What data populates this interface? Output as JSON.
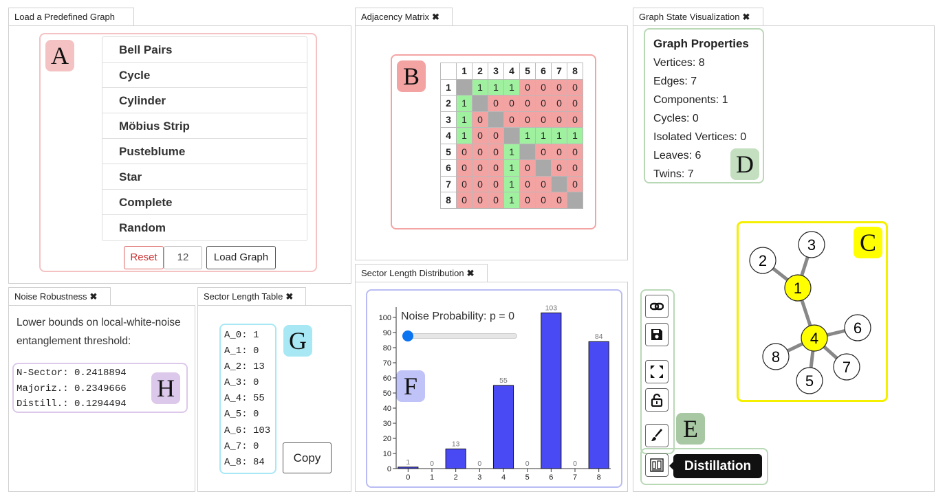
{
  "load_panel": {
    "tab_label": "Load a Predefined Graph",
    "annotation": "A",
    "graphs": [
      "Bell Pairs",
      "Cycle",
      "Cylinder",
      "Möbius Strip",
      "Pusteblume",
      "Star",
      "Complete",
      "Random"
    ],
    "reset_label": "Reset",
    "size_value": "12",
    "load_label": "Load Graph"
  },
  "adjacency_panel": {
    "tab_label": "Adjacency Matrix",
    "annotation": "B",
    "headers": [
      "1",
      "2",
      "3",
      "4",
      "5",
      "6",
      "7",
      "8"
    ],
    "rows": [
      [
        "",
        "1",
        "1",
        "1",
        "0",
        "0",
        "0",
        "0"
      ],
      [
        "1",
        "",
        "0",
        "0",
        "0",
        "0",
        "0",
        "0"
      ],
      [
        "1",
        "0",
        "",
        "0",
        "0",
        "0",
        "0",
        "0"
      ],
      [
        "1",
        "0",
        "0",
        "",
        "1",
        "1",
        "1",
        "1"
      ],
      [
        "0",
        "0",
        "0",
        "1",
        "",
        "0",
        "0",
        "0"
      ],
      [
        "0",
        "0",
        "0",
        "1",
        "0",
        "",
        "0",
        "0"
      ],
      [
        "0",
        "0",
        "0",
        "1",
        "0",
        "0",
        "",
        "0"
      ],
      [
        "0",
        "0",
        "0",
        "1",
        "0",
        "0",
        "0",
        ""
      ]
    ]
  },
  "graph_panel": {
    "tab_label": "Graph State Visualization",
    "properties_title": "Graph Properties",
    "properties": [
      "Vertices: 8",
      "Edges: 7",
      "Components: 1",
      "Cycles: 0",
      "Isolated Vertices: 0",
      "Leaves: 6",
      "Twins: 7"
    ],
    "annotation_props": "D",
    "annotation_graph": "C",
    "annotation_tools": "E",
    "nodes": [
      "1",
      "2",
      "3",
      "4",
      "5",
      "6",
      "7",
      "8"
    ],
    "highlight_color": "#ffff00",
    "tools": [
      "link-icon",
      "save-icon",
      "fit-view-icon",
      "unlock-icon",
      "brush-icon",
      "distillation-icon"
    ],
    "tooltip": "Distillation"
  },
  "noise_panel": {
    "tab_label": "Noise Robustness",
    "description": "Lower bounds on local-white-noise entanglement threshold:",
    "annotation": "H",
    "lines": [
      "N-Sector: 0.2418894",
      "Majoriz.: 0.2349666",
      "Distill.: 0.1294494"
    ]
  },
  "sector_table_panel": {
    "tab_label": "Sector Length Table",
    "annotation": "G",
    "lines": [
      "A_0: 1",
      "A_1: 0",
      "A_2: 13",
      "A_3: 0",
      "A_4: 55",
      "A_5: 0",
      "A_6: 103",
      "A_7: 0",
      "A_8: 84"
    ],
    "copy_label": "Copy"
  },
  "sector_dist_panel": {
    "tab_label": "Sector Length Distribution",
    "annotation": "F",
    "slider_label": "Noise Probability: p = 0",
    "slider_value": 0
  },
  "chart_data": {
    "type": "bar",
    "categories": [
      "0",
      "1",
      "2",
      "3",
      "4",
      "5",
      "6",
      "7",
      "8"
    ],
    "values": [
      1,
      0,
      13,
      0,
      55,
      0,
      103,
      0,
      84
    ],
    "ylim": [
      0,
      105
    ],
    "yticks": [
      "0",
      "10",
      "20",
      "30",
      "40",
      "50",
      "60",
      "70",
      "80",
      "90",
      "100"
    ],
    "bar_color": "#4a4af5",
    "grid": false
  },
  "colors": {
    "annotation_red": "#f4c2c2",
    "annotation_green": "#c3dfc0",
    "annotation_yellow": "#ffff00",
    "annotation_blue": "#bfc3f7",
    "annotation_cyan": "#a8e8f5",
    "annotation_purple": "#dcc8ea"
  }
}
